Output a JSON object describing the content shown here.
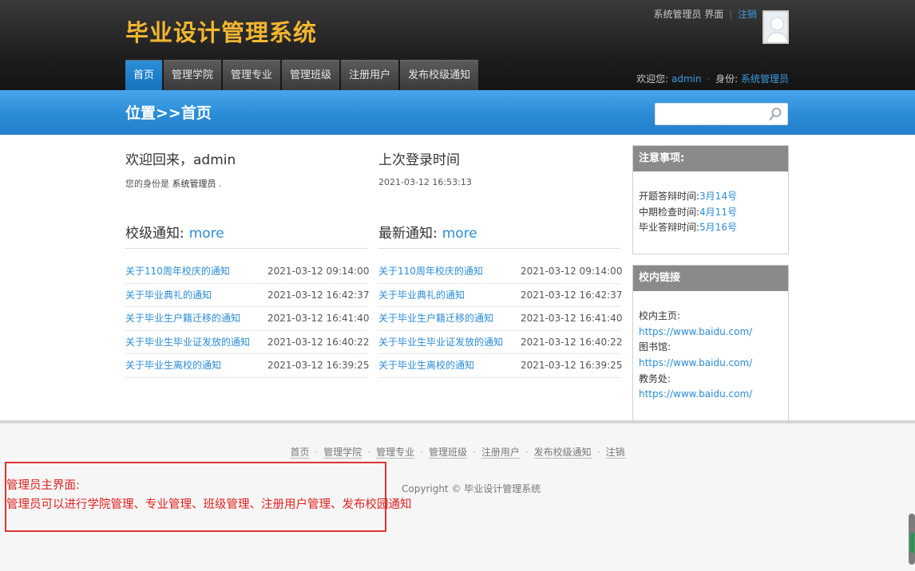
{
  "header": {
    "site_title": "毕业设计管理系统",
    "top_role_text": "系统管理员 界面",
    "top_separator": "|",
    "logout_label": "注销",
    "nav": [
      "首页",
      "管理学院",
      "管理专业",
      "管理班级",
      "注册用户",
      "发布校级通知"
    ],
    "welcome_label": "欢迎您:",
    "username": "admin",
    "dot": "·",
    "identity_label": "身份:",
    "identity_value": "系统管理员"
  },
  "bluebar": {
    "location": "位置>>首页",
    "search_placeholder": ""
  },
  "main": {
    "welcome_title": "欢迎回来，admin",
    "identity_prefix": "您的身份是",
    "identity_value": "系统管理员",
    "identity_suffix": ".",
    "last_login_title": "上次登录时间",
    "last_login_value": "2021-03-12 16:53:13",
    "school_notice_title": "校级通知:",
    "latest_notice_title": "最新通知:",
    "more_label": "more",
    "school_notices": [
      {
        "title": "关于110周年校庆的通知",
        "date": "2021-03-12 09:14:00"
      },
      {
        "title": "关于毕业典礼的通知",
        "date": "2021-03-12 16:42:37"
      },
      {
        "title": "关于毕业生户籍迁移的通知",
        "date": "2021-03-12 16:41:40"
      },
      {
        "title": "关于毕业生毕业证发放的通知",
        "date": "2021-03-12 16:40:22"
      },
      {
        "title": "关于毕业生离校的通知",
        "date": "2021-03-12 16:39:25"
      }
    ],
    "latest_notices": [
      {
        "title": "关于110周年校庆的通知",
        "date": "2021-03-12 09:14:00"
      },
      {
        "title": "关于毕业典礼的通知",
        "date": "2021-03-12 16:42:37"
      },
      {
        "title": "关于毕业生户籍迁移的通知",
        "date": "2021-03-12 16:41:40"
      },
      {
        "title": "关于毕业生毕业证发放的通知",
        "date": "2021-03-12 16:40:22"
      },
      {
        "title": "关于毕业生离校的通知",
        "date": "2021-03-12 16:39:25"
      }
    ]
  },
  "sidebar": {
    "notes_title": "注意事项:",
    "notes": [
      {
        "label": "开题答辩时间:",
        "value": "3月14号"
      },
      {
        "label": "中期检查时间:",
        "value": "4月11号"
      },
      {
        "label": "毕业答辩时间:",
        "value": "5月16号"
      }
    ],
    "links_title": "校内链接",
    "links": [
      {
        "label": "校内主页:",
        "url": "https://www.baidu.com/"
      },
      {
        "label": "图书馆:",
        "url": "https://www.baidu.com/"
      },
      {
        "label": "教务处:",
        "url": "https://www.baidu.com/"
      }
    ]
  },
  "footer": {
    "nav": [
      "首页",
      "管理学院",
      "管理专业",
      "管理班级",
      "注册用户",
      "发布校级通知",
      "注销"
    ],
    "separator": "·",
    "copyright": "Copyright © 毕业设计管理系统"
  },
  "annotation": {
    "line1": "管理员主界面:",
    "line2": "管理员可以进行学院管理、专业管理、班级管理、注册用户管理、发布校园通知",
    "border_color": "#e03333"
  },
  "colors": {
    "brand_title": "#f2b630",
    "accent_blue": "#2b8cd6",
    "active_tab": "#1f7fc9"
  }
}
